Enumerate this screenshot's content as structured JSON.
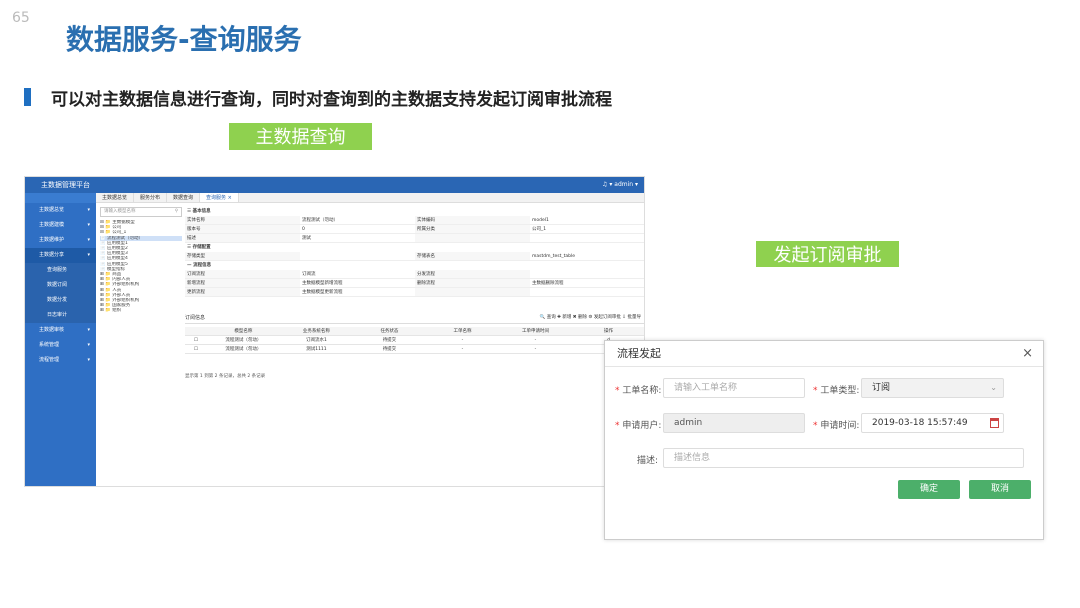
{
  "page_number": "65",
  "title": "数据服务-查询服务",
  "subtitle": "可以对主数据信息进行查询，同时对查询到的主数据支持发起订阅审批流程",
  "tag_query": "主数据查询",
  "tag_approval": "发起订阅审批",
  "app": {
    "title": "主数据管理平台",
    "user": "♫ ▾    admin ▾",
    "sidebar": [
      "主数据总览",
      "主数据建模",
      "主数据维护",
      "主数据分享",
      "查询服务",
      "数据订阅",
      "数据分发",
      "日志审计",
      "主数据审核",
      "系统管理",
      "流程管理"
    ],
    "tabs": [
      "主数据总览",
      "服务分布",
      "数据查询",
      "查询服务 ×"
    ],
    "tree_search": "请输入模型名称",
    "tree": [
      "⊟ 📁 主数据模型",
      "  ⊟ 📁 公司",
      "    ⊟ 📁 公司_1",
      "      📄 流程测试（勿动）",
      "      📄 应用模型1",
      "      📄 应用模型2",
      "      📄 应用模型3",
      "      📄 应用模型4",
      "      📄 应用模型5",
      "    📄 模型指标",
      "⊞ 📁 商品",
      "⊞ 📁 内部人员",
      "⊞ 📁 外部组织机构",
      "⊞ 📁 人员",
      "⊞ 📁 外部人员",
      "⊞ 📁 外部组织机构",
      "⊞ 📁 国家服务",
      "⊞ 📁 组织"
    ],
    "sec_basic": "☰ 基本信息",
    "basic_rows": [
      [
        "实体名称",
        "流程测试（勿动）",
        "实体编码",
        "model1"
      ],
      [
        "版本号",
        "0",
        "所属分类",
        "公司_1"
      ],
      [
        "描述",
        "测试",
        "",
        ""
      ]
    ],
    "sec_storage": "☰ 存储配置",
    "storage_rows": [
      [
        "存储类型",
        "",
        "存储表名",
        "mastdm_test_table"
      ]
    ],
    "sec_flow": "— 流程信息",
    "flow_rows": [
      [
        "订阅流程",
        "订阅流",
        "分发流程",
        ""
      ],
      [
        "新增流程",
        "主数据模型新增流程",
        "删除流程",
        "主数据删除流程"
      ],
      [
        "更新流程",
        "主数据模型更新流程",
        "",
        ""
      ]
    ],
    "sub_title": "订阅信息",
    "sub_actions": "🔍 查询   ✚ 新增   ✖ 删除   ⚙ 发起订阅审批   ⇩ 批量导",
    "sub_headers": [
      "",
      "模型名称",
      "业务系统名称",
      "任务状态",
      "工单名称",
      "工单申请时间",
      "操作"
    ],
    "sub_rows": [
      [
        "☐",
        "流程测试（勿动）",
        "订阅流水1",
        "待提交",
        "-",
        "-",
        "d"
      ],
      [
        "☐",
        "流程测试（勿动）",
        "测试1111",
        "待提交",
        "-",
        "-",
        "d"
      ]
    ],
    "pager": "显示第 1 到第 2 条记录，总共 2 条记录"
  },
  "dialog": {
    "title": "流程发起",
    "close": "×",
    "label_name": "工单名称:",
    "placeholder_name": "请输入工单名称",
    "label_type": "工单类型:",
    "value_type": "订阅",
    "label_user": "申请用户:",
    "value_user": "admin",
    "label_time": "申请时间:",
    "value_time": "2019-03-18 15:57:49",
    "label_desc": "描述:",
    "placeholder_desc": "描述信息",
    "confirm": "确定",
    "cancel": "取消"
  }
}
